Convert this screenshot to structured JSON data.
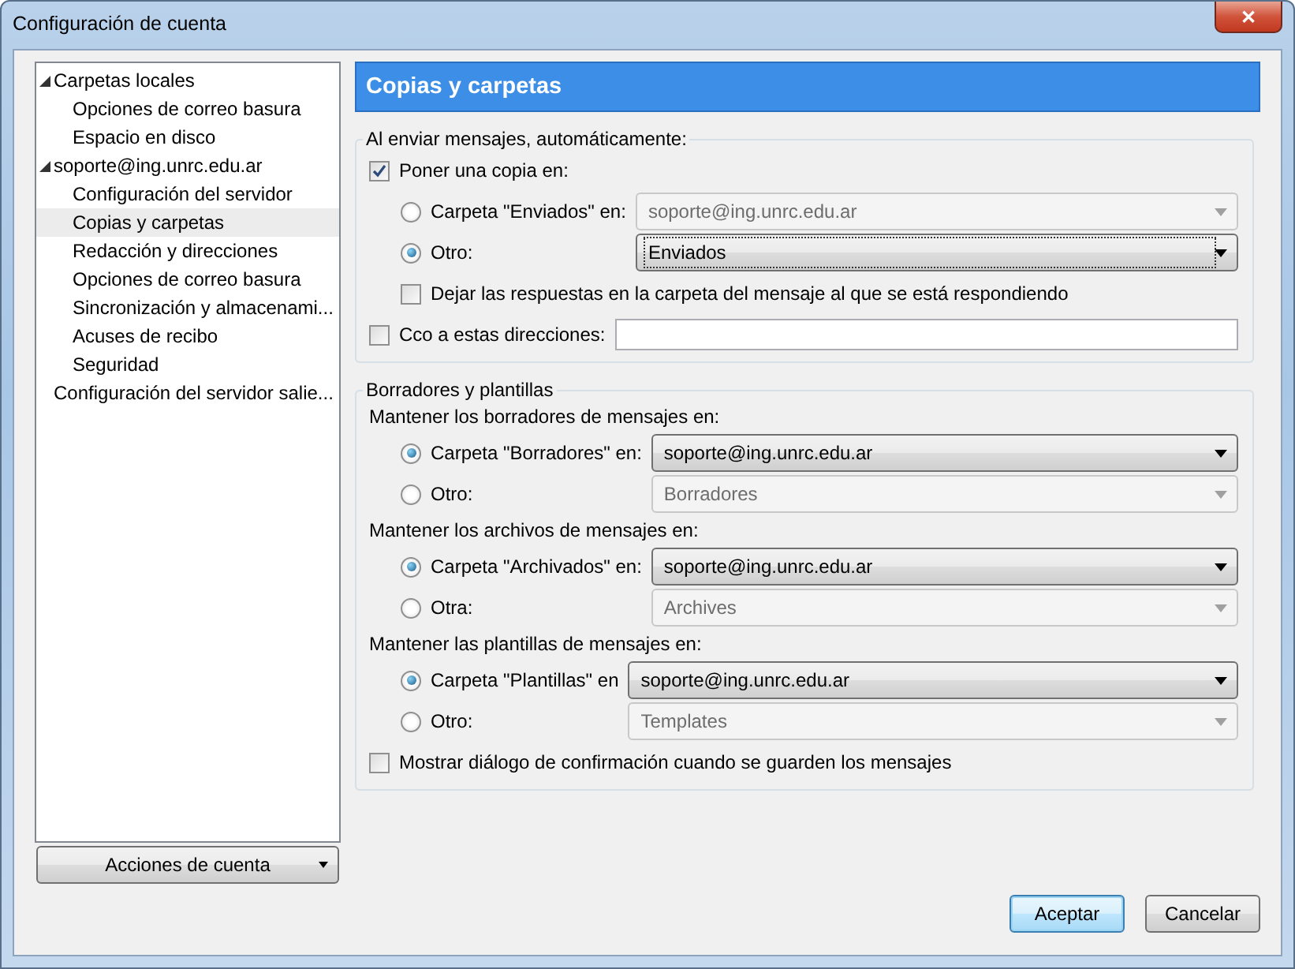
{
  "window": {
    "title": "Configuración de cuenta",
    "close": "✕"
  },
  "sidebar": {
    "items": [
      {
        "label": "Carpetas locales",
        "expanded": true,
        "selected": false,
        "children": [
          {
            "label": "Opciones de correo basura",
            "selected": false
          },
          {
            "label": "Espacio en disco",
            "selected": false
          }
        ]
      },
      {
        "label": "soporte@ing.unrc.edu.ar",
        "expanded": true,
        "selected": false,
        "children": [
          {
            "label": "Configuración del servidor",
            "selected": false
          },
          {
            "label": "Copias y carpetas",
            "selected": true
          },
          {
            "label": "Redacción y direcciones",
            "selected": false
          },
          {
            "label": "Opciones de correo basura",
            "selected": false
          },
          {
            "label": "Sincronización y almacenami...",
            "selected": false
          },
          {
            "label": "Acuses de recibo",
            "selected": false
          },
          {
            "label": "Seguridad",
            "selected": false
          }
        ]
      },
      {
        "label": "Configuración del servidor salie...",
        "selected": false
      }
    ]
  },
  "account_actions": {
    "label": "Acciones de cuenta"
  },
  "panel": {
    "title": "Copias y carpetas",
    "groups": [
      {
        "legend": "Al enviar mensajes, automáticamente:",
        "items": [
          {
            "kind": "checkbox",
            "label": "Poner una copia en:",
            "checked": true,
            "children": [
              {
                "kind": "radio",
                "label": "Carpeta \"Enviados\" en:",
                "selected": false,
                "dropdown": {
                  "value": "soporte@ing.unrc.edu.ar",
                  "disabled": true,
                  "focused": false
                }
              },
              {
                "kind": "radio",
                "label": "Otro:",
                "selected": true,
                "dropdown": {
                  "value": "Enviados",
                  "disabled": false,
                  "focused": true
                }
              },
              {
                "kind": "checkbox",
                "label": "Dejar las respuestas en la carpeta del mensaje al que se está respondiendo",
                "checked": false
              }
            ]
          },
          {
            "kind": "field",
            "label": "Cco a estas direcciones:",
            "checked": false
          }
        ]
      },
      {
        "legend": "Borradores y plantillas",
        "items": [
          {
            "kind": "heading",
            "label": "Mantener los borradores de mensajes en:",
            "children": [
              {
                "kind": "radio",
                "label": "Carpeta \"Borradores\" en:",
                "selected": true,
                "dropdown": {
                  "value": "soporte@ing.unrc.edu.ar",
                  "disabled": false,
                  "focused": false
                }
              },
              {
                "kind": "radio",
                "label": "Otro:",
                "selected": false,
                "dropdown": {
                  "value": "Borradores",
                  "disabled": true,
                  "focused": false
                }
              }
            ]
          },
          {
            "kind": "heading",
            "label": "Mantener los archivos de mensajes en:",
            "children": [
              {
                "kind": "radio",
                "label": "Carpeta \"Archivados\" en:",
                "selected": true,
                "dropdown": {
                  "value": "soporte@ing.unrc.edu.ar",
                  "disabled": false,
                  "focused": false
                }
              },
              {
                "kind": "radio",
                "label": "Otra:",
                "selected": false,
                "dropdown": {
                  "value": "Archives",
                  "disabled": true,
                  "focused": false
                }
              }
            ]
          },
          {
            "kind": "heading",
            "label": "Mantener las plantillas de mensajes en:",
            "children": [
              {
                "kind": "radio",
                "label": "Carpeta \"Plantillas\" en",
                "selected": true,
                "dropdown": {
                  "value": "soporte@ing.unrc.edu.ar",
                  "disabled": false,
                  "focused": false
                }
              },
              {
                "kind": "radio",
                "label": "Otro:",
                "selected": false,
                "dropdown": {
                  "value": "Templates",
                  "disabled": true,
                  "focused": false
                }
              }
            ]
          },
          {
            "kind": "checkbox",
            "label": "Mostrar diálogo de confirmación cuando se guarden los mensajes",
            "checked": false
          }
        ]
      }
    ]
  },
  "buttons": [
    {
      "label": "Aceptar",
      "default": true
    },
    {
      "label": "Cancelar",
      "default": false
    }
  ]
}
